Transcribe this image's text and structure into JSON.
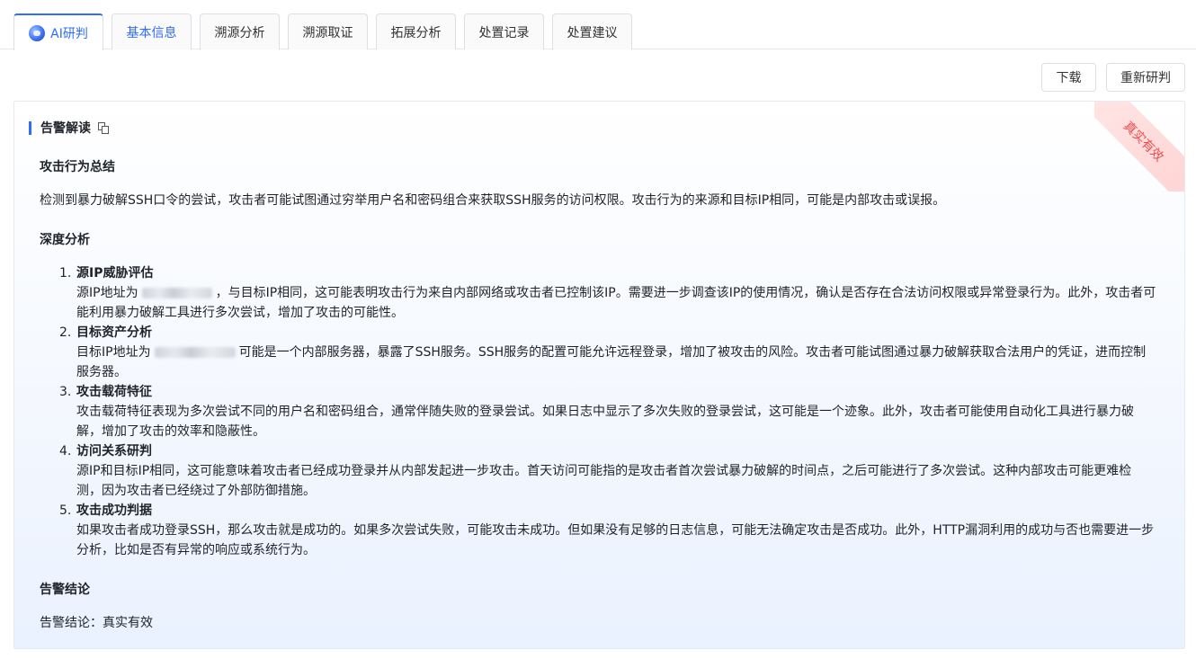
{
  "tabs": [
    {
      "label": "AI研判",
      "active": true,
      "icon": "ai-assistant-icon"
    },
    {
      "label": "基本信息"
    },
    {
      "label": "溯源分析"
    },
    {
      "label": "溯源取证"
    },
    {
      "label": "拓展分析"
    },
    {
      "label": "处置记录"
    },
    {
      "label": "处置建议"
    }
  ],
  "toolbar": {
    "download_label": "下载",
    "rejudge_label": "重新研判"
  },
  "card": {
    "ribbon": "真实有效",
    "title": "告警解读",
    "summary_heading": "攻击行为总结",
    "summary_text": "检测到暴力破解SSH口令的尝试，攻击者可能试图通过穷举用户名和密码组合来获取SSH服务的访问权限。攻击行为的来源和目标IP相同，可能是内部攻击或误报。",
    "deep_heading": "深度分析",
    "items": [
      {
        "num": "1.",
        "title": "源IP威胁评估",
        "pre": "源IP地址为",
        "post": "，与目标IP相同，这可能表明攻击行为来自内部网络或攻击者已控制该IP。需要进一步调查该IP的使用情况，确认是否存在合法访问权限或异常登录行为。此外，攻击者可能利用暴力破解工具进行多次尝试，增加了攻击的可能性。"
      },
      {
        "num": "2.",
        "title": "目标资产分析",
        "pre": "目标IP地址为",
        "post": "可能是一个内部服务器，暴露了SSH服务。SSH服务的配置可能允许远程登录，增加了被攻击的风险。攻击者可能试图通过暴力破解获取合法用户的凭证，进而控制服务器。"
      },
      {
        "num": "3.",
        "title": "攻击载荷特征",
        "text": "攻击载荷特征表现为多次尝试不同的用户名和密码组合，通常伴随失败的登录尝试。如果日志中显示了多次失败的登录尝试，这可能是一个迹象。此外，攻击者可能使用自动化工具进行暴力破解，增加了攻击的效率和隐蔽性。"
      },
      {
        "num": "4.",
        "title": "访问关系研判",
        "text": "源IP和目标IP相同，这可能意味着攻击者已经成功登录并从内部发起进一步攻击。首天访问可能指的是攻击者首次尝试暴力破解的时间点，之后可能进行了多次尝试。这种内部攻击可能更难检测，因为攻击者已经绕过了外部防御措施。"
      },
      {
        "num": "5.",
        "title": "攻击成功判据",
        "text": "如果攻击者成功登录SSH，那么攻击就是成功的。如果多次尝试失败，可能攻击未成功。但如果没有足够的日志信息，可能无法确定攻击是否成功。此外，HTTP漏洞利用的成功与否也需要进一步分析，比如是否有异常的响应或系统行为。"
      }
    ],
    "conclusion_heading": "告警结论",
    "conclusion_text": "告警结论：真实有效"
  },
  "colors": {
    "accent": "#2f6bff",
    "ribbon_text": "#f04a4a"
  }
}
